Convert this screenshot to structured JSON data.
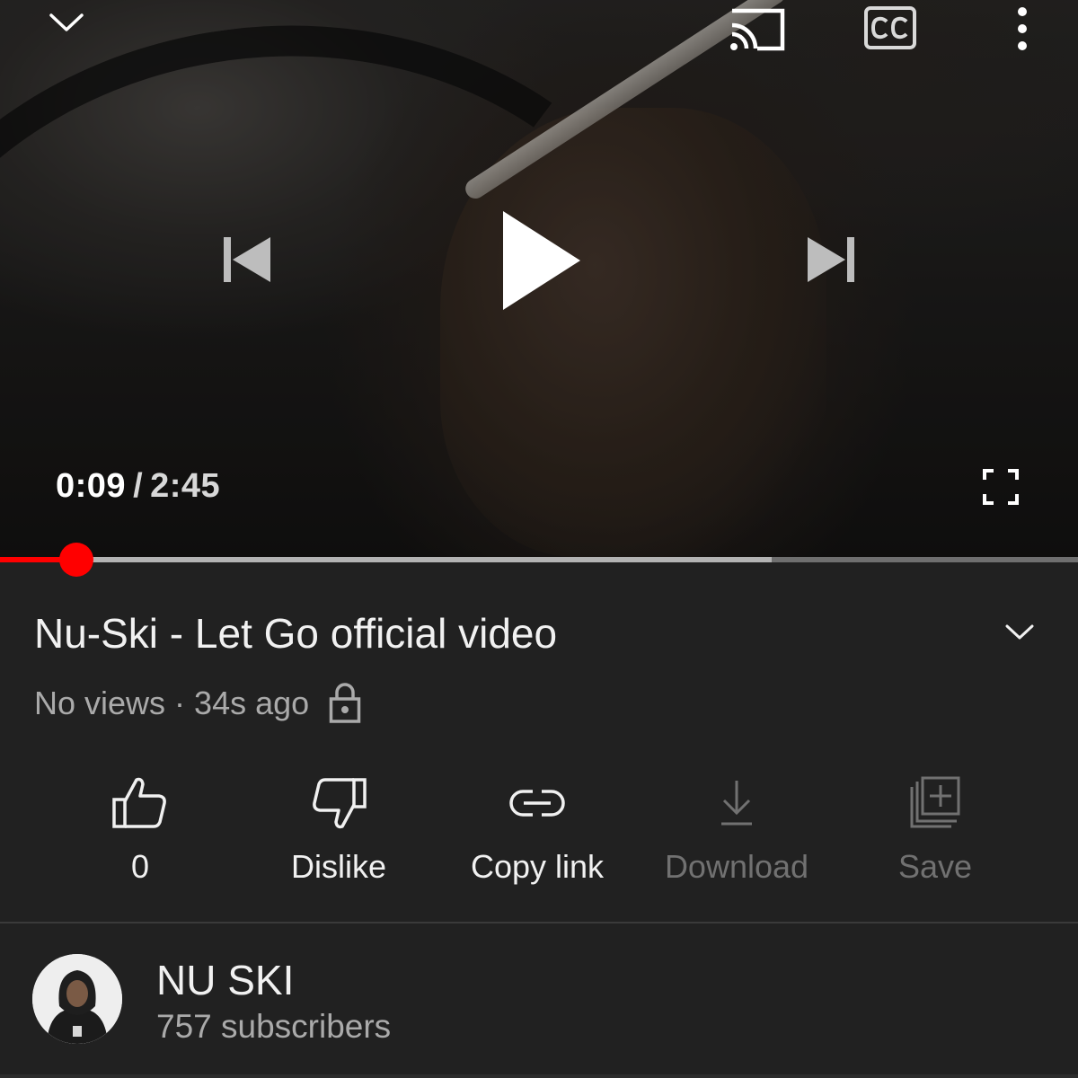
{
  "player": {
    "current_time": "0:09",
    "separator": "/",
    "duration": "2:45",
    "progress_played_fraction": 0.071,
    "progress_buffered_fraction": 0.716,
    "icons": {
      "collapse": "chevron-down-icon",
      "cast": "cast-icon",
      "captions": "cc-icon",
      "more": "more-vert-icon",
      "previous": "skip-previous-icon",
      "play": "play-icon",
      "next": "skip-next-icon",
      "fullscreen": "fullscreen-icon"
    }
  },
  "video": {
    "title": "Nu-Ski - Let Go official video",
    "views": "No views",
    "dot": "·",
    "age": "34s ago",
    "privacy_icon": "lock-icon",
    "expand_icon": "chevron-down-icon"
  },
  "actions": [
    {
      "label": "0",
      "icon": "thumbs-up-icon",
      "enabled": true
    },
    {
      "label": "Dislike",
      "icon": "thumbs-down-icon",
      "enabled": true
    },
    {
      "label": "Copy link",
      "icon": "link-icon",
      "enabled": true
    },
    {
      "label": "Download",
      "icon": "download-icon",
      "enabled": false
    },
    {
      "label": "Save",
      "icon": "playlist-add-icon",
      "enabled": false
    }
  ],
  "channel": {
    "name": "NU SKI",
    "subscribers": "757 subscribers"
  },
  "colors": {
    "background": "#212121",
    "progress_played": "#ff0000",
    "text_primary": "#f1f1f1",
    "text_secondary": "#aaaaaa",
    "text_disabled": "#717171"
  }
}
